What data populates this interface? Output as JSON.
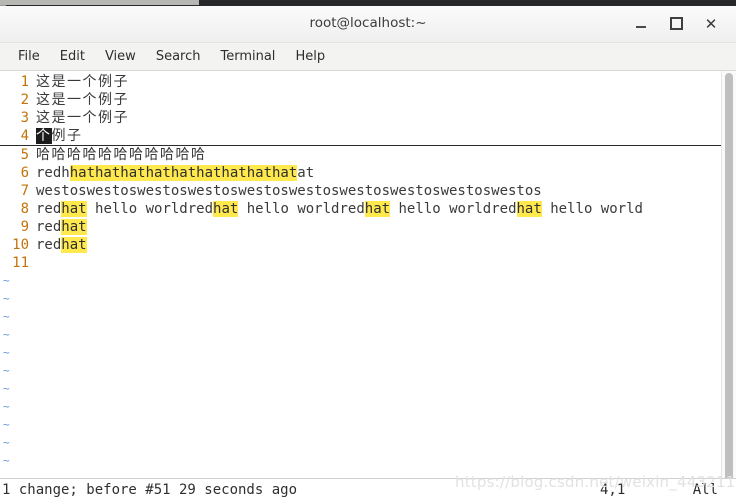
{
  "window": {
    "title": "root@localhost:~",
    "minimize_label": "–",
    "maximize_label": "□",
    "close_label": "✕"
  },
  "menubar": {
    "items": [
      {
        "label": "File"
      },
      {
        "label": "Edit"
      },
      {
        "label": "View"
      },
      {
        "label": "Search"
      },
      {
        "label": "Terminal"
      },
      {
        "label": "Help"
      }
    ]
  },
  "editor": {
    "lines": [
      {
        "num": "1",
        "segments": [
          {
            "text": "这是一个例子",
            "style": "han"
          }
        ]
      },
      {
        "num": "2",
        "segments": [
          {
            "text": "这是一个例子",
            "style": "han"
          }
        ]
      },
      {
        "num": "3",
        "segments": [
          {
            "text": "这是一个例子",
            "style": "han"
          }
        ]
      },
      {
        "num": "4",
        "underline": true,
        "segments": [
          {
            "text": "个",
            "style": "cursor han"
          },
          {
            "text": "例子",
            "style": "han"
          }
        ]
      },
      {
        "num": "5",
        "segments": [
          {
            "text": "哈哈哈哈哈哈哈哈哈哈哈",
            "style": "han"
          }
        ]
      },
      {
        "num": "6",
        "segments": [
          {
            "text": "redh",
            "style": ""
          },
          {
            "text": "hathathathathathathathathat",
            "style": "hl"
          },
          {
            "text": "at",
            "style": ""
          }
        ]
      },
      {
        "num": "7",
        "segments": [
          {
            "text": "westoswestoswestoswestoswestoswestoswestoswestoswestoswestos",
            "style": ""
          }
        ]
      },
      {
        "num": "8",
        "segments": [
          {
            "text": "red",
            "style": ""
          },
          {
            "text": "hat",
            "style": "hl"
          },
          {
            "text": " hello worldred",
            "style": ""
          },
          {
            "text": "hat",
            "style": "hl"
          },
          {
            "text": " hello worldred",
            "style": ""
          },
          {
            "text": "hat",
            "style": "hl"
          },
          {
            "text": " hello worldred",
            "style": ""
          },
          {
            "text": "hat",
            "style": "hl"
          },
          {
            "text": " hello world",
            "style": ""
          }
        ]
      },
      {
        "num": "9",
        "segments": [
          {
            "text": "red",
            "style": ""
          },
          {
            "text": "hat",
            "style": "hl"
          }
        ]
      },
      {
        "num": "10",
        "segments": [
          {
            "text": "red",
            "style": ""
          },
          {
            "text": "hat",
            "style": "hl"
          }
        ]
      },
      {
        "num": "11",
        "segments": [
          {
            "text": "",
            "style": ""
          }
        ]
      }
    ],
    "empty_marker": "~",
    "empty_marker_count": 11
  },
  "statusbar": {
    "message": "1 change; before #51  29 seconds ago",
    "position": "4,1",
    "scroll": "All"
  },
  "watermark": {
    "text": "https://blog.csdn.net/weixin_44321116"
  },
  "colors": {
    "line_number": "#c4720a",
    "highlight": "#ffe94d",
    "cursor": "#1d1d1d",
    "tilde": "#5b8fd6",
    "text": "#3a3a3a"
  }
}
